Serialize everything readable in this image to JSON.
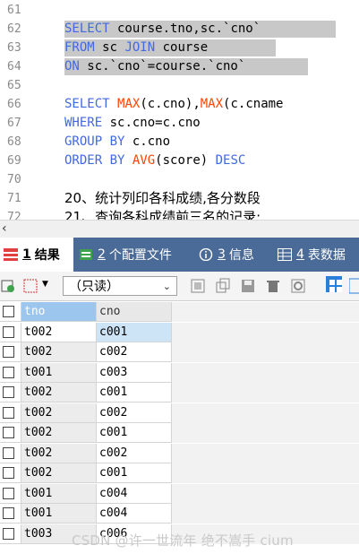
{
  "editor": {
    "lines": [
      {
        "no": "61",
        "segs": []
      },
      {
        "no": "62",
        "selected": true,
        "segs": [
          {
            "t": "SELECT",
            "k": "kw"
          },
          {
            "t": " course.tno,sc.`cno`"
          }
        ]
      },
      {
        "no": "63",
        "selected": true,
        "segs": [
          {
            "t": "FROM",
            "k": "kw"
          },
          {
            "t": " sc "
          },
          {
            "t": "JOIN",
            "k": "kw"
          },
          {
            "t": " course"
          }
        ]
      },
      {
        "no": "64",
        "selected": true,
        "segs": [
          {
            "t": "ON",
            "k": "kw"
          },
          {
            "t": " sc.`cno`=course.`cno`"
          }
        ]
      },
      {
        "no": "65",
        "segs": []
      },
      {
        "no": "66",
        "segs": [
          {
            "t": "SELECT",
            "k": "kw"
          },
          {
            "t": " "
          },
          {
            "t": "MAX",
            "k": "fn"
          },
          {
            "t": "(c.cno),"
          },
          {
            "t": "MAX",
            "k": "fn"
          },
          {
            "t": "(c.cname"
          }
        ]
      },
      {
        "no": "67",
        "segs": [
          {
            "t": "WHERE",
            "k": "kw"
          },
          {
            "t": " sc.cno=c.cno"
          }
        ]
      },
      {
        "no": "68",
        "segs": [
          {
            "t": "GROUP BY",
            "k": "kw"
          },
          {
            "t": " c.cno"
          }
        ]
      },
      {
        "no": "69",
        "segs": [
          {
            "t": "ORDER BY",
            "k": "kw"
          },
          {
            "t": " "
          },
          {
            "t": "AVG",
            "k": "fn"
          },
          {
            "t": "(score) "
          },
          {
            "t": "DESC",
            "k": "kw"
          }
        ]
      },
      {
        "no": "70",
        "segs": []
      },
      {
        "no": "71",
        "cn": true,
        "segs": [
          {
            "t": "20、统计列印各科成绩,各分数段"
          }
        ]
      },
      {
        "no": "72",
        "cn": true,
        "segs": [
          {
            "t": "21、查询各科成绩前三名的记录;"
          }
        ]
      }
    ]
  },
  "tabs": [
    {
      "num": "1",
      "label": "结果",
      "icon": "result-grid-icon",
      "active": true
    },
    {
      "num": "2",
      "label": "个配置文件",
      "icon": "profile-icon",
      "active": false
    },
    {
      "num": "3",
      "label": "信息",
      "icon": "info-icon",
      "active": false
    },
    {
      "num": "4",
      "label": "表数据",
      "icon": "table-data-icon",
      "active": false
    }
  ],
  "toolbar": {
    "mode_value": "（只读）"
  },
  "grid": {
    "columns": [
      "tno",
      "cno"
    ],
    "rows": [
      [
        "t002",
        "c001"
      ],
      [
        "t002",
        "c002"
      ],
      [
        "t001",
        "c003"
      ],
      [
        "t002",
        "c001"
      ],
      [
        "t002",
        "c002"
      ],
      [
        "t002",
        "c001"
      ],
      [
        "t002",
        "c002"
      ],
      [
        "t002",
        "c001"
      ],
      [
        "t001",
        "c004"
      ],
      [
        "t001",
        "c004"
      ],
      [
        "t003",
        "c006"
      ]
    ]
  },
  "watermark": "CSDN @许一世流年 绝不嵩手 cium"
}
